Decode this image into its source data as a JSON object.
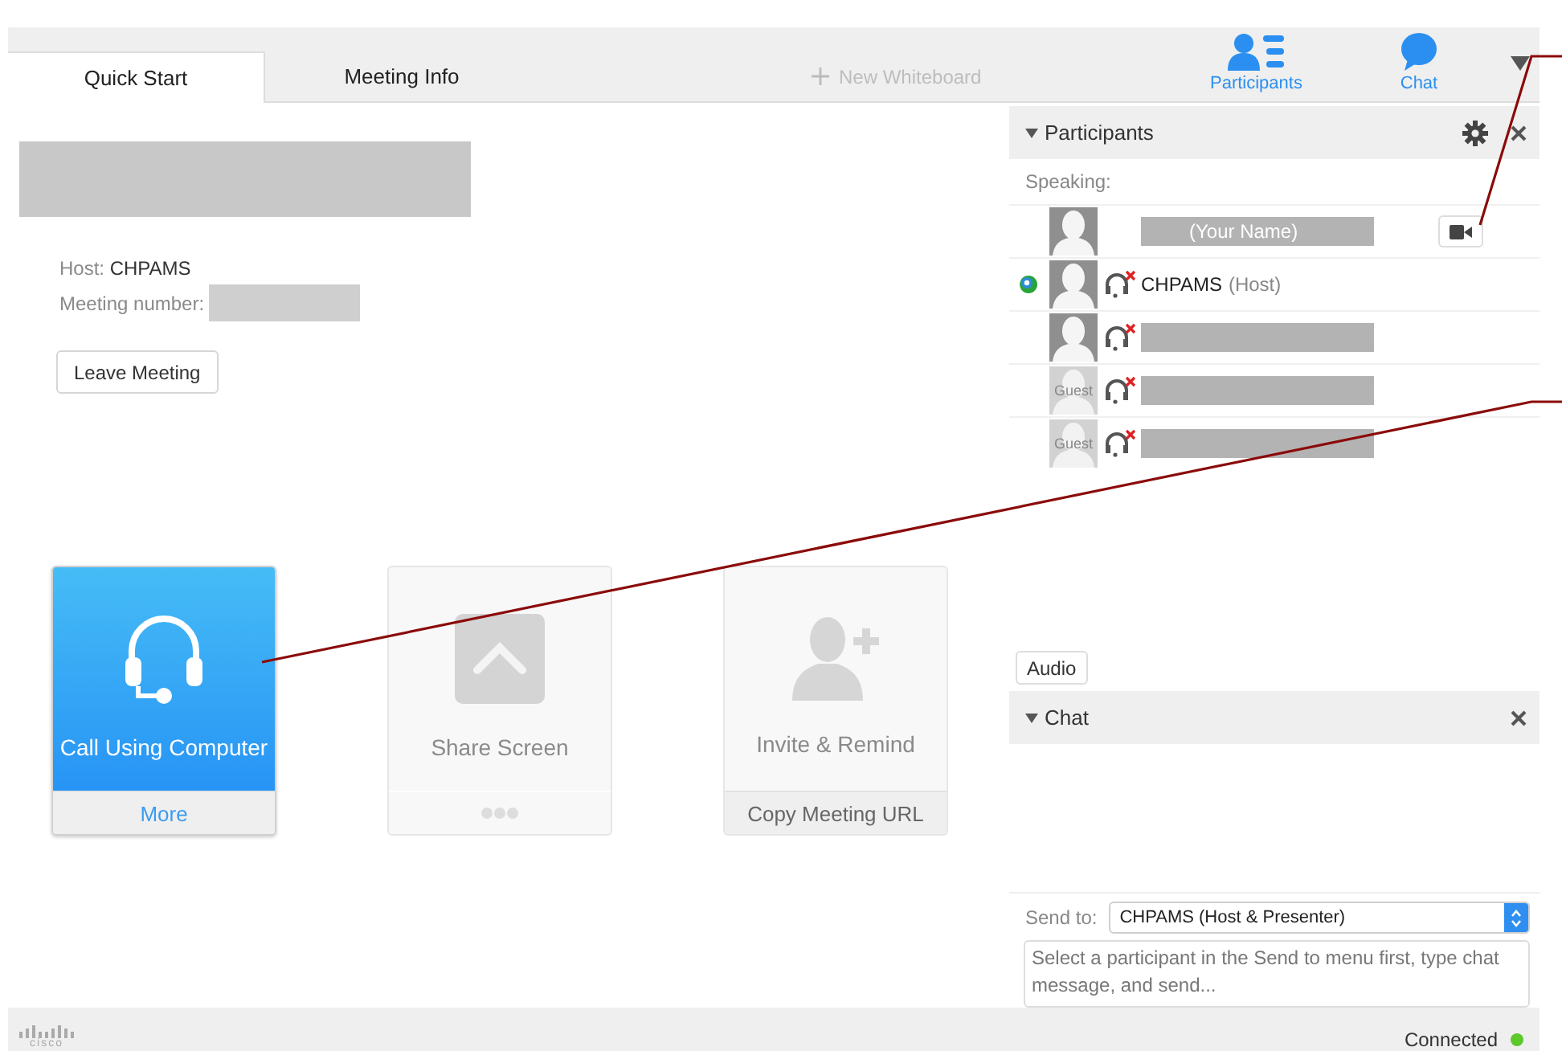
{
  "tabs": [
    {
      "label": "Quick Start",
      "selected": true
    },
    {
      "label": "Meeting Info",
      "selected": false
    }
  ],
  "new_whiteboard": {
    "label": "New Whiteboard",
    "disabled": true
  },
  "panel_buttons": [
    {
      "kind": "participants",
      "label": "Participants"
    },
    {
      "kind": "chat",
      "label": "Chat"
    }
  ],
  "meeting": {
    "host_label": "Host:",
    "host": "CHPAMS",
    "number_label": "Meeting number:",
    "number_redacted": true,
    "leave_button": "Leave Meeting"
  },
  "tiles": [
    {
      "kind": "call",
      "label": "Call Using Computer",
      "footer": "More",
      "active": true
    },
    {
      "kind": "share",
      "label": "Share Screen",
      "active": false
    },
    {
      "kind": "invite",
      "label": "Invite & Remind",
      "footer": "Copy Meeting URL",
      "active": false
    }
  ],
  "participants_panel": {
    "title": "Participants",
    "section": "Speaking:",
    "rows": [
      {
        "kind": "user",
        "name": "(Your Name)",
        "redacted": true,
        "presenter": false,
        "video_button": true
      },
      {
        "kind": "user",
        "name": "CHPAMS",
        "role": "(Host)",
        "redacted": false,
        "presenter": true,
        "audio_muted": true,
        "video_button": false
      },
      {
        "kind": "user",
        "redacted": true,
        "presenter": false,
        "audio_muted": true,
        "video_button": false
      },
      {
        "kind": "guest",
        "avatar_label": "Guest",
        "redacted": true,
        "presenter": false,
        "audio_muted": true,
        "video_button": false
      },
      {
        "kind": "guest",
        "avatar_label": "Guest",
        "redacted": true,
        "presenter": false,
        "audio_muted": true,
        "video_button": false
      }
    ]
  },
  "audio_button": "Audio",
  "chat_panel": {
    "title": "Chat",
    "send_to_label": "Send to:",
    "send_to": "CHPAMS (Host & Presenter)",
    "placeholder": "Select a participant in the Send to menu first, type chat message, and send..."
  },
  "status_bar": {
    "logo": "cisco",
    "status": "Connected",
    "connected": true
  }
}
